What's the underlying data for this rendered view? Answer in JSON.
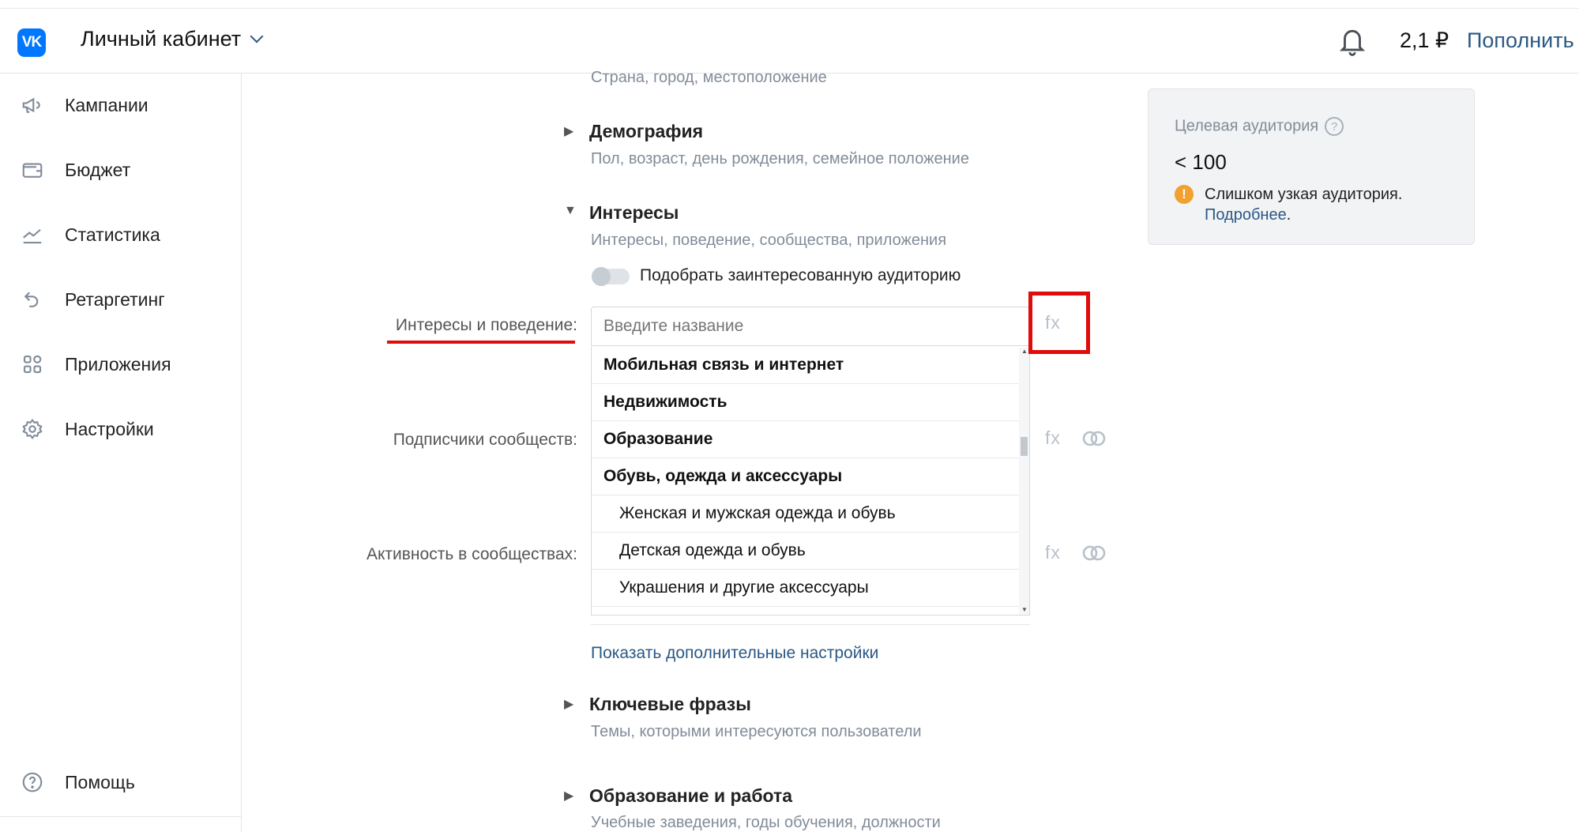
{
  "header": {
    "logo": "vk",
    "cabinet_label": "Личный кабинет",
    "balance": "2,1 ₽",
    "topup_label": "Пополнить"
  },
  "sidebar": {
    "items": [
      {
        "label": "Кампании",
        "icon": "megaphone-icon"
      },
      {
        "label": "Бюджет",
        "icon": "wallet-icon"
      },
      {
        "label": "Статистика",
        "icon": "trend-chart-icon"
      },
      {
        "label": "Ретаргетинг",
        "icon": "return-arrow-icon"
      },
      {
        "label": "Приложения",
        "icon": "apps-grid-icon"
      },
      {
        "label": "Настройки",
        "icon": "gear-icon"
      }
    ],
    "help_label": "Помощь"
  },
  "form": {
    "geo_desc": "Страна, город, местоположение",
    "demography": {
      "title": "Демография",
      "desc": "Пол, возраст, день рождения, семейное положение"
    },
    "interests": {
      "title": "Интересы",
      "desc": "Интересы, поведение, сообщества, приложения"
    },
    "auto_audience_label": "Подобрать заинтересованную аудиторию",
    "fields": {
      "interests_behavior": "Интересы и поведение:",
      "community_subscribers": "Подписчики сообществ:",
      "community_activity": "Активность в сообществах:"
    },
    "search_placeholder": "Введите название",
    "fx_label": "fx",
    "dropdown_items": [
      {
        "label": "Мобильная связь и интернет",
        "bold": true
      },
      {
        "label": "Недвижимость",
        "bold": true
      },
      {
        "label": "Образование",
        "bold": true
      },
      {
        "label": "Обувь, одежда и аксессуары",
        "bold": true
      },
      {
        "label": "Женская и мужская одежда и обувь",
        "bold": false
      },
      {
        "label": "Детская одежда и обувь",
        "bold": false
      },
      {
        "label": "Украшения и другие аксессуары",
        "bold": false
      }
    ],
    "more_settings_link": "Показать дополнительные настройки",
    "keywords": {
      "title": "Ключевые фразы",
      "desc": "Темы, которыми интересуются пользователи"
    },
    "education": {
      "title": "Образование и работа",
      "desc": "Учебные заведения, годы обучения, должности"
    }
  },
  "audience": {
    "title": "Целевая аудитория",
    "value": "< 100",
    "warning_text": "Слишком узкая аудитория.",
    "more_link": "Подробнее",
    "period": "."
  },
  "colors": {
    "accent": "#2a5885",
    "brand": "#0077ff",
    "highlight": "#e10b0b",
    "warning": "#f0a12f"
  }
}
